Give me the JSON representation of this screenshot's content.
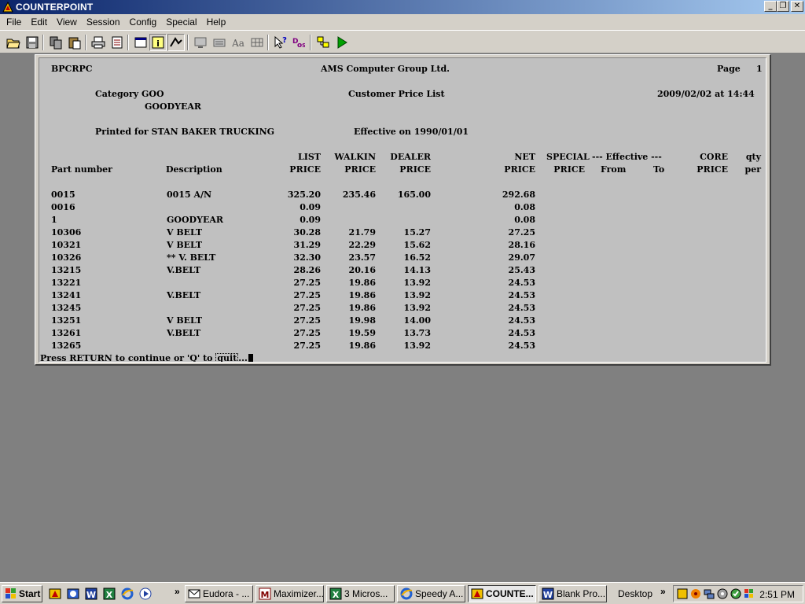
{
  "window": {
    "title": "COUNTERPOINT"
  },
  "menu": [
    "File",
    "Edit",
    "View",
    "Session",
    "Config",
    "Special",
    "Help"
  ],
  "toolbar_icons": [
    "open-folder-icon",
    "save-disk-icon",
    "copy-icon",
    "paste-icon",
    "print-icon",
    "print-preview-icon",
    "window-icon",
    "info-icon",
    "toggle-icon",
    "screen-icon",
    "keyboard-icon",
    "font-icon",
    "grid-icon",
    "help-pointer-icon",
    "dos-icon",
    "macro-icon",
    "run-icon"
  ],
  "report": {
    "program": "BPCRPC",
    "company": "AMS Computer Group Ltd.",
    "page_label": "Page",
    "page_number": "1",
    "category_line": "Category GOO",
    "category_name": "GOODYEAR",
    "report_title": "Customer Price List",
    "date_time": "2009/02/02 at 14:44",
    "printed_for": "Printed for STAN BAKER TRUCKING",
    "effective": "Effective on 1990/01/01",
    "headers_top": {
      "list": "LIST",
      "walkin": "WALKIN",
      "dealer": "DEALER",
      "net": "NET",
      "special": "SPECIAL",
      "effective": "--- Effective ---",
      "core": "CORE",
      "qty": "qty"
    },
    "headers_bottom": {
      "part": "Part number",
      "description": "Description",
      "list": "PRICE",
      "walkin": "PRICE",
      "dealer": "PRICE",
      "net": "PRICE",
      "special": "PRICE",
      "from": "From",
      "to": "To",
      "core": "PRICE",
      "qty": "per"
    },
    "rows": [
      {
        "part": "0015",
        "desc": "0015 A/N",
        "list": "325.20",
        "walkin": "235.46",
        "dealer": "165.00",
        "net": "292.68"
      },
      {
        "part": "0016",
        "desc": "",
        "list": "0.09",
        "walkin": "",
        "dealer": "",
        "net": "0.08"
      },
      {
        "part": "1",
        "desc": "GOODYEAR",
        "list": "0.09",
        "walkin": "",
        "dealer": "",
        "net": "0.08"
      },
      {
        "part": "10306",
        "desc": "V BELT",
        "list": "30.28",
        "walkin": "21.79",
        "dealer": "15.27",
        "net": "27.25"
      },
      {
        "part": "10321",
        "desc": "V BELT",
        "list": "31.29",
        "walkin": "22.29",
        "dealer": "15.62",
        "net": "28.16"
      },
      {
        "part": "10326",
        "desc": "** V. BELT",
        "list": "32.30",
        "walkin": "23.57",
        "dealer": "16.52",
        "net": "29.07"
      },
      {
        "part": "13215",
        "desc": "V.BELT",
        "list": "28.26",
        "walkin": "20.16",
        "dealer": "14.13",
        "net": "25.43"
      },
      {
        "part": "13221",
        "desc": "",
        "list": "27.25",
        "walkin": "19.86",
        "dealer": "13.92",
        "net": "24.53"
      },
      {
        "part": "13241",
        "desc": "V.BELT",
        "list": "27.25",
        "walkin": "19.86",
        "dealer": "13.92",
        "net": "24.53"
      },
      {
        "part": "13245",
        "desc": "",
        "list": "27.25",
        "walkin": "19.86",
        "dealer": "13.92",
        "net": "24.53"
      },
      {
        "part": "13251",
        "desc": "V BELT",
        "list": "27.25",
        "walkin": "19.98",
        "dealer": "14.00",
        "net": "24.53"
      },
      {
        "part": "13261",
        "desc": "V.BELT",
        "list": "27.25",
        "walkin": "19.59",
        "dealer": "13.73",
        "net": "24.53"
      },
      {
        "part": "13265",
        "desc": "",
        "list": "27.25",
        "walkin": "19.86",
        "dealer": "13.92",
        "net": "24.53"
      }
    ],
    "prompt_prefix": "Press RETURN to continue or 'Q' to ",
    "prompt_boxed": "quit",
    "prompt_suffix": "..."
  },
  "taskbar": {
    "start_label": "Start",
    "buttons": [
      {
        "label": "Eudora - ...",
        "icon": "eudora-icon"
      },
      {
        "label": "Maximizer...",
        "icon": "maximizer-icon"
      },
      {
        "label": "3 Micros...",
        "icon": "excel-icon"
      },
      {
        "label": "Speedy A...",
        "icon": "ie-icon"
      },
      {
        "label": "COUNTE...",
        "icon": "counterpoint-icon",
        "active": true
      },
      {
        "label": "Blank Pro...",
        "icon": "word-icon"
      }
    ],
    "desktop_label": "Desktop",
    "clock": "2:51 PM"
  }
}
